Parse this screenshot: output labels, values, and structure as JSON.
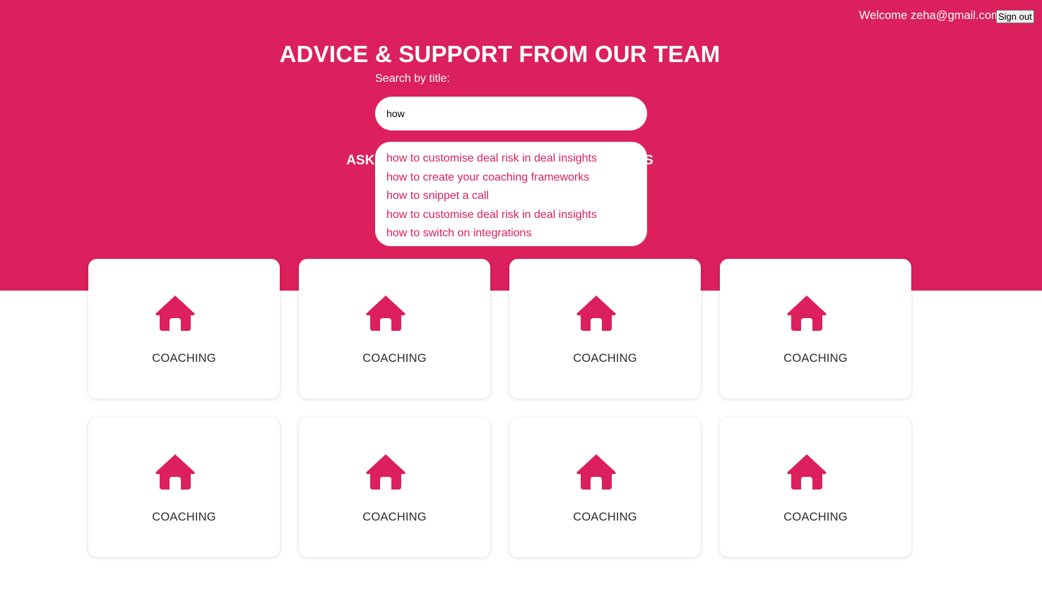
{
  "header": {
    "welcome_text": "Welcome zeha@gmail.com",
    "signout_label": "Sign out"
  },
  "hero": {
    "title": "ADVICE & SUPPORT FROM OUR TEAM",
    "search_label": "Search by title:",
    "search_value": "how",
    "ask_text": "ASK OUR TEAM A QUESTION OR MESSAGE US"
  },
  "suggestions": [
    "how to customise deal risk in deal insights",
    "how to create your coaching frameworks",
    "how to snippet a call",
    "how to customise deal risk in deal insights",
    "how to switch on integrations"
  ],
  "cards": [
    {
      "label": "COACHING",
      "icon": "home-icon"
    },
    {
      "label": "COACHING",
      "icon": "home-icon"
    },
    {
      "label": "COACHING",
      "icon": "home-icon"
    },
    {
      "label": "COACHING",
      "icon": "home-icon"
    },
    {
      "label": "COACHING",
      "icon": "home-icon"
    },
    {
      "label": "COACHING",
      "icon": "home-icon"
    },
    {
      "label": "COACHING",
      "icon": "home-icon"
    },
    {
      "label": "COACHING",
      "icon": "home-icon"
    }
  ],
  "colors": {
    "brand": "#dc1f5d",
    "card_text": "#2b2b2b",
    "background": "#ffffff"
  }
}
